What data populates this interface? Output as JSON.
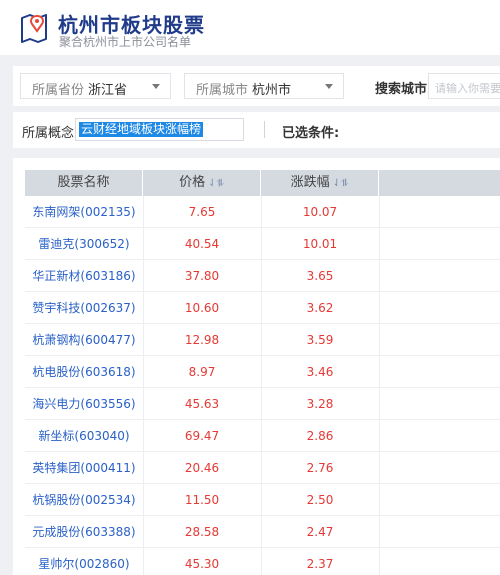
{
  "header": {
    "title": "杭州市板块股票",
    "subtitle": "聚合杭州市上市公司名单"
  },
  "filters": {
    "province_label": "所属省份",
    "province_value": "浙江省",
    "city_label": "所属城市",
    "city_value": "杭州市",
    "search_label": "搜索城市",
    "search_placeholder": "请输入你需要搜索"
  },
  "concept": {
    "label": "所属概念",
    "value": "云财经地域板块涨幅榜",
    "selected_label": "已选条件:"
  },
  "table": {
    "headers": [
      "股票名称",
      "价格",
      "涨跌幅"
    ],
    "sort_icon": "⇃⥮",
    "rows": [
      {
        "name": "东南网架(002135)",
        "price": "7.65",
        "change": "10.07"
      },
      {
        "name": "雷迪克(300652)",
        "price": "40.54",
        "change": "10.01"
      },
      {
        "name": "华正新材(603186)",
        "price": "37.80",
        "change": "3.65"
      },
      {
        "name": "赞宇科技(002637)",
        "price": "10.60",
        "change": "3.62"
      },
      {
        "name": "杭萧钢构(600477)",
        "price": "12.98",
        "change": "3.59"
      },
      {
        "name": "杭电股份(603618)",
        "price": "8.97",
        "change": "3.46"
      },
      {
        "name": "海兴电力(603556)",
        "price": "45.63",
        "change": "3.28"
      },
      {
        "name": "新坐标(603040)",
        "price": "69.47",
        "change": "2.86"
      },
      {
        "name": "英特集团(000411)",
        "price": "20.46",
        "change": "2.76"
      },
      {
        "name": "杭锅股份(002534)",
        "price": "11.50",
        "change": "2.50"
      },
      {
        "name": "元成股份(603388)",
        "price": "28.58",
        "change": "2.47"
      },
      {
        "name": "星帅尔(002860)",
        "price": "45.30",
        "change": "2.37"
      }
    ]
  },
  "colors": {
    "title": "#1f3b8a",
    "stock_link": "#2a61c9",
    "rise": "#e53935",
    "selection": "#1e88e5"
  }
}
